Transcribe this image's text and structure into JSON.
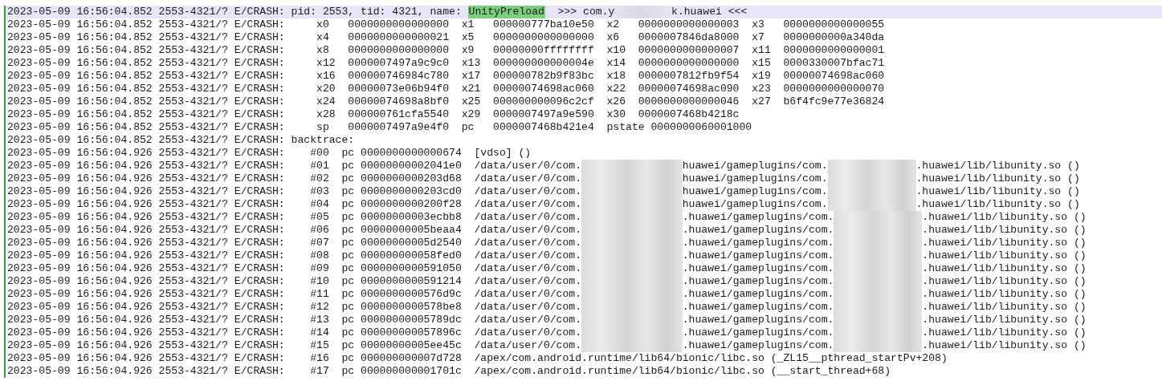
{
  "log_lines": [
    {
      "selected": true,
      "segments": [
        {
          "kind": "text",
          "text": "2023-05-09 16:56:04.852 2553-4321/? E/CRASH: pid: 2553, tid: 4321, name: "
        },
        {
          "kind": "highlight",
          "text": "UnityPreload"
        },
        {
          "kind": "text",
          "text": "  >>> com.y"
        },
        {
          "kind": "blur"
        },
        {
          "kind": "text",
          "text": "k.huawei <<<"
        }
      ]
    },
    {
      "selected": false,
      "segments": [
        {
          "kind": "text",
          "text": "2023-05-09 16:56:04.852 2553-4321/? E/CRASH:     x0   0000000000000000  x1   000000777ba10e50  x2   0000000000000003  x3   0000000000000055"
        }
      ]
    },
    {
      "selected": false,
      "segments": [
        {
          "kind": "text",
          "text": "2023-05-09 16:56:04.852 2553-4321/? E/CRASH:     x4   0000000000000021  x5   0000000000000000  x6   0000007846da8000  x7   0000000000a340da"
        }
      ]
    },
    {
      "selected": false,
      "segments": [
        {
          "kind": "text",
          "text": "2023-05-09 16:56:04.852 2553-4321/? E/CRASH:     x8   0000000000000000  x9   00000000ffffffff  x10  0000000000000007  x11  0000000000000001"
        }
      ]
    },
    {
      "selected": false,
      "segments": [
        {
          "kind": "text",
          "text": "2023-05-09 16:56:04.852 2553-4321/? E/CRASH:     x12  0000007497a9c9c0  x13  000000000000004e  x14  0000000000000000  x15  0000330007bfac71"
        }
      ]
    },
    {
      "selected": false,
      "segments": [
        {
          "kind": "text",
          "text": "2023-05-09 16:56:04.852 2553-4321/? E/CRASH:     x16  000000746984c780  x17  000000782b9f83bc  x18  0000007812fb9f54  x19  00000074698ac060"
        }
      ]
    },
    {
      "selected": false,
      "segments": [
        {
          "kind": "text",
          "text": "2023-05-09 16:56:04.852 2553-4321/? E/CRASH:     x20  00000073e06b94f0  x21  00000074698ac060  x22  00000074698ac090  x23  0000000000000070"
        }
      ]
    },
    {
      "selected": false,
      "segments": [
        {
          "kind": "text",
          "text": "2023-05-09 16:56:04.852 2553-4321/? E/CRASH:     x24  00000074698a8bf0  x25  000000000096c2cf  x26  0000000000000046  x27  b6f4fc9e77e36824"
        }
      ]
    },
    {
      "selected": false,
      "segments": [
        {
          "kind": "text",
          "text": "2023-05-09 16:56:04.852 2553-4321/? E/CRASH:     x28  000000761cfa5540  x29  0000007497a9e590  x30  0000007468b4218c"
        }
      ]
    },
    {
      "selected": false,
      "segments": [
        {
          "kind": "text",
          "text": "2023-05-09 16:56:04.852 2553-4321/? E/CRASH:     sp   0000007497a9e4f0  pc   0000007468b421e4  pstate 0000000060001000"
        }
      ]
    },
    {
      "selected": false,
      "segments": [
        {
          "kind": "text",
          "text": "2023-05-09 16:56:04.852 2553-4321/? E/CRASH: backtrace:"
        }
      ]
    },
    {
      "selected": false,
      "segments": [
        {
          "kind": "text",
          "text": "2023-05-09 16:56:04.926 2553-4321/? E/CRASH:    #00  pc 0000000000000674  [vdso] ()"
        }
      ]
    },
    {
      "selected": false,
      "segments": [
        {
          "kind": "text",
          "text": "2023-05-09 16:56:04.926 2553-4321/? E/CRASH:    #01  pc 00000000002041e0  /data/user/0/com."
        },
        {
          "kind": "blur"
        },
        {
          "kind": "text",
          "text": "huawei/gameplugins/com."
        },
        {
          "kind": "blur"
        },
        {
          "kind": "text",
          "text": ".huawei/lib/libunity.so ()"
        }
      ]
    },
    {
      "selected": false,
      "segments": [
        {
          "kind": "text",
          "text": "2023-05-09 16:56:04.926 2553-4321/? E/CRASH:    #02  pc 0000000000203d68  /data/user/0/com."
        },
        {
          "kind": "blur"
        },
        {
          "kind": "text",
          "text": "huawei/gameplugins/com."
        },
        {
          "kind": "blur"
        },
        {
          "kind": "text",
          "text": ".huawei/lib/libunity.so ()"
        }
      ]
    },
    {
      "selected": false,
      "segments": [
        {
          "kind": "text",
          "text": "2023-05-09 16:56:04.926 2553-4321/? E/CRASH:    #03  pc 0000000000203cd0  /data/user/0/com."
        },
        {
          "kind": "blur"
        },
        {
          "kind": "text",
          "text": "huawei/gameplugins/com."
        },
        {
          "kind": "blur"
        },
        {
          "kind": "text",
          "text": ".huawei/lib/libunity.so ()"
        }
      ]
    },
    {
      "selected": false,
      "segments": [
        {
          "kind": "text",
          "text": "2023-05-09 16:56:04.926 2553-4321/? E/CRASH:    #04  pc 0000000000200f28  /data/user/0/com."
        },
        {
          "kind": "blur"
        },
        {
          "kind": "text",
          "text": "huawei/gameplugins/com."
        },
        {
          "kind": "blur"
        },
        {
          "kind": "text",
          "text": ".huawei/lib/libunity.so ()"
        }
      ]
    },
    {
      "selected": false,
      "segments": [
        {
          "kind": "text",
          "text": "2023-05-09 16:56:04.926 2553-4321/? E/CRASH:    #05  pc 00000000003ecbb8  /data/user/0/com."
        },
        {
          "kind": "blur"
        },
        {
          "kind": "text",
          "text": ".huawei/gameplugins/com."
        },
        {
          "kind": "blur"
        },
        {
          "kind": "text",
          "text": ".huawei/lib/libunity.so ()"
        }
      ]
    },
    {
      "selected": false,
      "segments": [
        {
          "kind": "text",
          "text": "2023-05-09 16:56:04.926 2553-4321/? E/CRASH:    #06  pc 00000000005beaa4  /data/user/0/com."
        },
        {
          "kind": "blur"
        },
        {
          "kind": "text",
          "text": ".huawei/gameplugins/com."
        },
        {
          "kind": "blur"
        },
        {
          "kind": "text",
          "text": ".huawei/lib/libunity.so ()"
        }
      ]
    },
    {
      "selected": false,
      "segments": [
        {
          "kind": "text",
          "text": "2023-05-09 16:56:04.926 2553-4321/? E/CRASH:    #07  pc 00000000005d2540  /data/user/0/com."
        },
        {
          "kind": "blur"
        },
        {
          "kind": "text",
          "text": ".huawei/gameplugins/com."
        },
        {
          "kind": "blur"
        },
        {
          "kind": "text",
          "text": ".huawei/lib/libunity.so ()"
        }
      ]
    },
    {
      "selected": false,
      "segments": [
        {
          "kind": "text",
          "text": "2023-05-09 16:56:04.926 2553-4321/? E/CRASH:    #08  pc 000000000058fed0  /data/user/0/com."
        },
        {
          "kind": "blur"
        },
        {
          "kind": "text",
          "text": ".huawei/gameplugins/com."
        },
        {
          "kind": "blur"
        },
        {
          "kind": "text",
          "text": ".huawei/lib/libunity.so ()"
        }
      ]
    },
    {
      "selected": false,
      "segments": [
        {
          "kind": "text",
          "text": "2023-05-09 16:56:04.926 2553-4321/? E/CRASH:    #09  pc 0000000000591050  /data/user/0/com."
        },
        {
          "kind": "blur"
        },
        {
          "kind": "text",
          "text": ".huawei/gameplugins/com."
        },
        {
          "kind": "blur"
        },
        {
          "kind": "text",
          "text": ".huawei/lib/libunity.so ()"
        }
      ]
    },
    {
      "selected": false,
      "segments": [
        {
          "kind": "text",
          "text": "2023-05-09 16:56:04.926 2553-4321/? E/CRASH:    #10  pc 0000000000591214  /data/user/0/com."
        },
        {
          "kind": "blur"
        },
        {
          "kind": "text",
          "text": ".huawei/gameplugins/com."
        },
        {
          "kind": "blur"
        },
        {
          "kind": "text",
          "text": ".huawei/lib/libunity.so ()"
        }
      ]
    },
    {
      "selected": false,
      "segments": [
        {
          "kind": "text",
          "text": "2023-05-09 16:56:04.926 2553-4321/? E/CRASH:    #11  pc 0000000000576d9c  /data/user/0/com."
        },
        {
          "kind": "blur"
        },
        {
          "kind": "text",
          "text": ".huawei/gameplugins/com."
        },
        {
          "kind": "blur"
        },
        {
          "kind": "text",
          "text": ".huawei/lib/libunity.so ()"
        }
      ]
    },
    {
      "selected": false,
      "segments": [
        {
          "kind": "text",
          "text": "2023-05-09 16:56:04.926 2553-4321/? E/CRASH:    #12  pc 0000000000578be8  /data/user/0/com."
        },
        {
          "kind": "blur"
        },
        {
          "kind": "text",
          "text": ".huawei/gameplugins/com."
        },
        {
          "kind": "blur"
        },
        {
          "kind": "text",
          "text": ".huawei/lib/libunity.so ()"
        }
      ]
    },
    {
      "selected": false,
      "segments": [
        {
          "kind": "text",
          "text": "2023-05-09 16:56:04.926 2553-4321/? E/CRASH:    #13  pc 00000000005789dc  /data/user/0/com."
        },
        {
          "kind": "blur"
        },
        {
          "kind": "text",
          "text": ".huawei/gameplugins/com."
        },
        {
          "kind": "blur"
        },
        {
          "kind": "text",
          "text": ".huawei/lib/libunity.so ()"
        }
      ]
    },
    {
      "selected": false,
      "segments": [
        {
          "kind": "text",
          "text": "2023-05-09 16:56:04.926 2553-4321/? E/CRASH:    #14  pc 000000000057896c  /data/user/0/com."
        },
        {
          "kind": "blur"
        },
        {
          "kind": "text",
          "text": ".huawei/gameplugins/com."
        },
        {
          "kind": "blur"
        },
        {
          "kind": "text",
          "text": ".huawei/lib/libunity.so ()"
        }
      ]
    },
    {
      "selected": false,
      "segments": [
        {
          "kind": "text",
          "text": "2023-05-09 16:56:04.926 2553-4321/? E/CRASH:    #15  pc 00000000005ee45c  /data/user/0/com."
        },
        {
          "kind": "blur"
        },
        {
          "kind": "text",
          "text": ".huawei/gameplugins/com."
        },
        {
          "kind": "blur"
        },
        {
          "kind": "text",
          "text": ".huawei/lib/libunity.so ()"
        }
      ]
    },
    {
      "selected": false,
      "segments": [
        {
          "kind": "text",
          "text": "2023-05-09 16:56:04.926 2553-4321/? E/CRASH:    #16  pc 000000000007d728  /apex/com.android.runtime/lib64/bionic/libc.so (_ZL15__pthread_startPv+208)"
        }
      ]
    },
    {
      "selected": false,
      "segments": [
        {
          "kind": "text",
          "text": "2023-05-09 16:56:04.926 2553-4321/? E/CRASH:    #17  pc 000000000001701c  /apex/com.android.runtime/lib64/bionic/libc.so (__start_thread+68)"
        }
      ]
    }
  ]
}
